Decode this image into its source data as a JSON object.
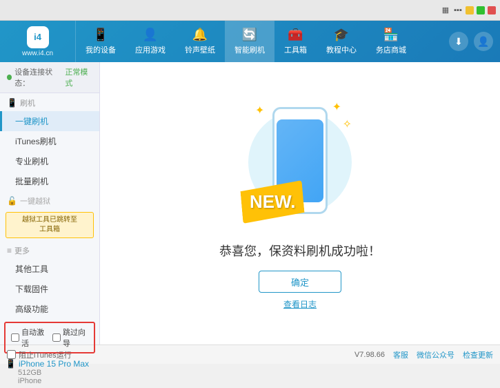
{
  "topBar": {
    "icons": [
      "wifi",
      "battery",
      "minimize",
      "maximize",
      "close"
    ]
  },
  "header": {
    "logo": {
      "symbol": "i4",
      "url": "www.i4.cn"
    },
    "nav": [
      {
        "id": "my-device",
        "icon": "📱",
        "label": "我的设备"
      },
      {
        "id": "apps-games",
        "icon": "👤",
        "label": "应用游戏"
      },
      {
        "id": "ringtone",
        "icon": "🔔",
        "label": "铃声壁纸"
      },
      {
        "id": "smart-flash",
        "icon": "🔄",
        "label": "智能刷机",
        "active": true
      },
      {
        "id": "toolbox",
        "icon": "🧰",
        "label": "工具箱"
      },
      {
        "id": "tutorial",
        "icon": "🎓",
        "label": "教程中心"
      },
      {
        "id": "service-store",
        "icon": "🏪",
        "label": "务店商城"
      }
    ],
    "rightBtns": [
      "download",
      "user"
    ]
  },
  "sidebar": {
    "statusLabel": "设备连接状态：",
    "statusMode": "正常模式",
    "sections": [
      {
        "id": "flash",
        "icon": "📱",
        "label": "刷机",
        "items": [
          {
            "id": "one-key-flash",
            "label": "一键刷机",
            "active": true
          },
          {
            "id": "itunes-flash",
            "label": "iTunes刷机"
          },
          {
            "id": "pro-flash",
            "label": "专业刷机"
          },
          {
            "id": "batch-flash",
            "label": "批量刷机"
          }
        ]
      },
      {
        "id": "one-key-jailbreak",
        "icon": "🔓",
        "label": "一键越狱",
        "disabled": true,
        "notice": "越狱工具已跳转至\n工具箱"
      },
      {
        "id": "more",
        "icon": "≡",
        "label": "更多",
        "items": [
          {
            "id": "other-tools",
            "label": "其他工具"
          },
          {
            "id": "download-fw",
            "label": "下载固件"
          },
          {
            "id": "advanced",
            "label": "高级功能"
          }
        ]
      }
    ],
    "checkboxRow": {
      "autoActivate": {
        "label": "自动激活",
        "checked": false
      },
      "guide": {
        "label": "跳过向导",
        "checked": false
      }
    },
    "device": {
      "icon": "📱",
      "name": "iPhone 15 Pro Max",
      "storage": "512GB",
      "type": "iPhone"
    }
  },
  "content": {
    "newBadgeText": "NEW.",
    "successMessage": "恭喜您，保资料刷机成功啦！",
    "confirmBtnLabel": "确定",
    "logLinkLabel": "查看日志"
  },
  "statusBar": {
    "itunesLabel": "阻止iTunes运行",
    "version": "V7.98.66",
    "links": [
      "客服",
      "微信公众号",
      "检查更新"
    ]
  }
}
